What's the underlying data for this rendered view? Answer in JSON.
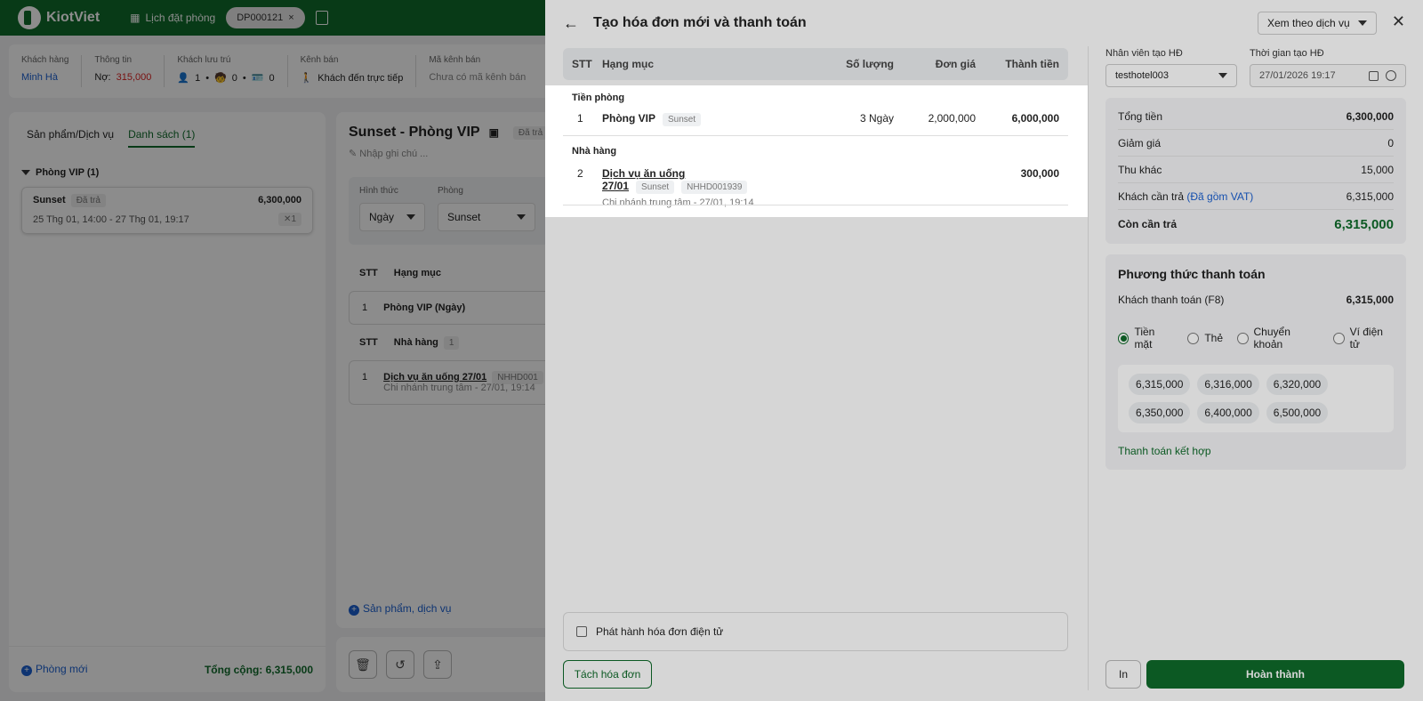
{
  "bg": {
    "logo": "KiotViet",
    "booking_link": "Lịch đặt phòng",
    "booking_code": "DP000121",
    "info": {
      "customer_label": "Khách hàng",
      "customer_value": "Minh Hà",
      "info_label": "Thông tin",
      "debt_prefix": "Nợ:",
      "debt_value": "315,000",
      "guests_label": "Khách lưu trú",
      "adults": "1",
      "children": "0",
      "ids": "0",
      "channel_label": "Kênh bán",
      "channel_value": "Khách đến trực tiếp",
      "channel_code_label": "Mã kênh bán",
      "channel_code_value": "Chưa có mã kênh bán"
    },
    "left": {
      "tab1": "Sản phẩm/Dịch vụ",
      "tab2": "Danh sách (1)",
      "group": "Phòng VIP (1)",
      "card_name": "Sunset",
      "card_tag": "Đã trả",
      "card_amount": "6,300,000",
      "card_time": "25 Thg 01, 14:00 - 27 Thg 01, 19:17",
      "card_count": "1",
      "new_room": "Phòng mới",
      "total": "Tổng cộng: 6,315,000"
    },
    "mid": {
      "title": "Sunset - Phòng VIP",
      "tag": "Đã trả",
      "note": "Nhập ghi chú ...",
      "form_label1": "Hình thức",
      "form_label2": "Phòng",
      "form_value1": "Ngày",
      "form_value2": "Sunset",
      "th_stt": "STT",
      "th_item": "Hạng mục",
      "row1_stt": "1",
      "row1_item": "Phòng VIP (Ngày)",
      "th2_item": "Nhà hàng",
      "th2_count": "1",
      "row2_stt": "1",
      "row2_item": "Dịch vụ ăn uống 27/01",
      "row2_code": "NHHD001",
      "row2_sub": "Chi nhánh trung tâm - 27/01, 19:14",
      "add_link": "Sản phẩm, dịch vụ"
    }
  },
  "modal": {
    "title": "Tạo hóa đơn mới và thanh toán",
    "view_select": "Xem theo dịch vụ",
    "table": {
      "headers": {
        "stt": "STT",
        "item": "Hạng mục",
        "qty": "Số lượng",
        "price": "Đơn giá",
        "total": "Thành tiền"
      },
      "section1": "Tiền phòng",
      "row1": {
        "stt": "1",
        "name": "Phòng VIP",
        "tag": "Sunset",
        "qty": "3 Ngày",
        "price": "2,000,000",
        "total": "6,000,000"
      },
      "section2": "Nhà hàng",
      "row2": {
        "stt": "2",
        "name": "Dịch vụ ăn uống 27/01",
        "tag": "Sunset",
        "code": "NHHD001939",
        "sub": "Chi nhánh trung tâm - 27/01, 19:14",
        "total": "300,000"
      }
    },
    "einvoice_label": "Phát hành hóa đơn điện tử",
    "split_button": "Tách hóa đơn",
    "staff_label": "Nhân viên tạo HĐ",
    "staff_value": "testhotel003",
    "time_label": "Thời gian tạo HĐ",
    "time_value": "27/01/2026 19:17",
    "summary": {
      "total_label": "Tổng tiền",
      "total_value": "6,300,000",
      "discount_label": "Giảm giá",
      "discount_value": "0",
      "other_label": "Thu khác",
      "other_value": "15,000",
      "pay_label": "Khách cần trả",
      "pay_vat": "(Đã gồm VAT)",
      "pay_value": "6,315,000",
      "remain_label": "Còn cần trả",
      "remain_value": "6,315,000"
    },
    "payment": {
      "title": "Phương thức thanh toán",
      "customer_pay_label": "Khách thanh toán (F8)",
      "customer_pay_value": "6,315,000",
      "methods": [
        "Tiền mặt",
        "Thẻ",
        "Chuyển khoản",
        "Ví điện tử"
      ],
      "quick_amounts": [
        "6,315,000",
        "6,316,000",
        "6,320,000",
        "6,350,000",
        "6,400,000",
        "6,500,000"
      ],
      "combo_link": "Thanh toán kết hợp"
    },
    "print_button": "In",
    "done_button": "Hoàn thành"
  }
}
